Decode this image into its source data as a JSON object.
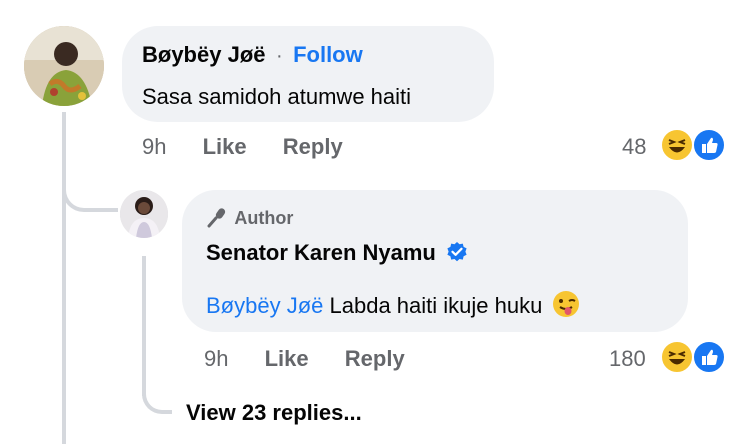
{
  "comment1": {
    "author": "Bøybëy  Jøë",
    "separator": "·",
    "follow_label": "Follow",
    "text": "Sasa samidoh atumwe haiti",
    "time": "9h",
    "like_label": "Like",
    "reply_label": "Reply",
    "reaction_count": "48",
    "reactions": [
      "laughing-emoji-icon",
      "thumbs-up-icon"
    ]
  },
  "reply1": {
    "badge_label": "Author",
    "author": "Senator Karen Nyamu",
    "verified": true,
    "mention": "Bøybëy  Jøë",
    "text": "Labda haiti ikuje huku",
    "emoji": "winking-tongue-emoji",
    "time": "9h",
    "like_label": "Like",
    "reply_label": "Reply",
    "reaction_count": "180",
    "reactions": [
      "laughing-emoji-icon",
      "thumbs-up-icon"
    ]
  },
  "view_replies_label": "View 23 replies...",
  "colors": {
    "accent_blue": "#1877f2",
    "bubble_bg": "#f0f2f5",
    "meta_gray": "#65676b",
    "emoji_yellow": "#f7c531"
  }
}
